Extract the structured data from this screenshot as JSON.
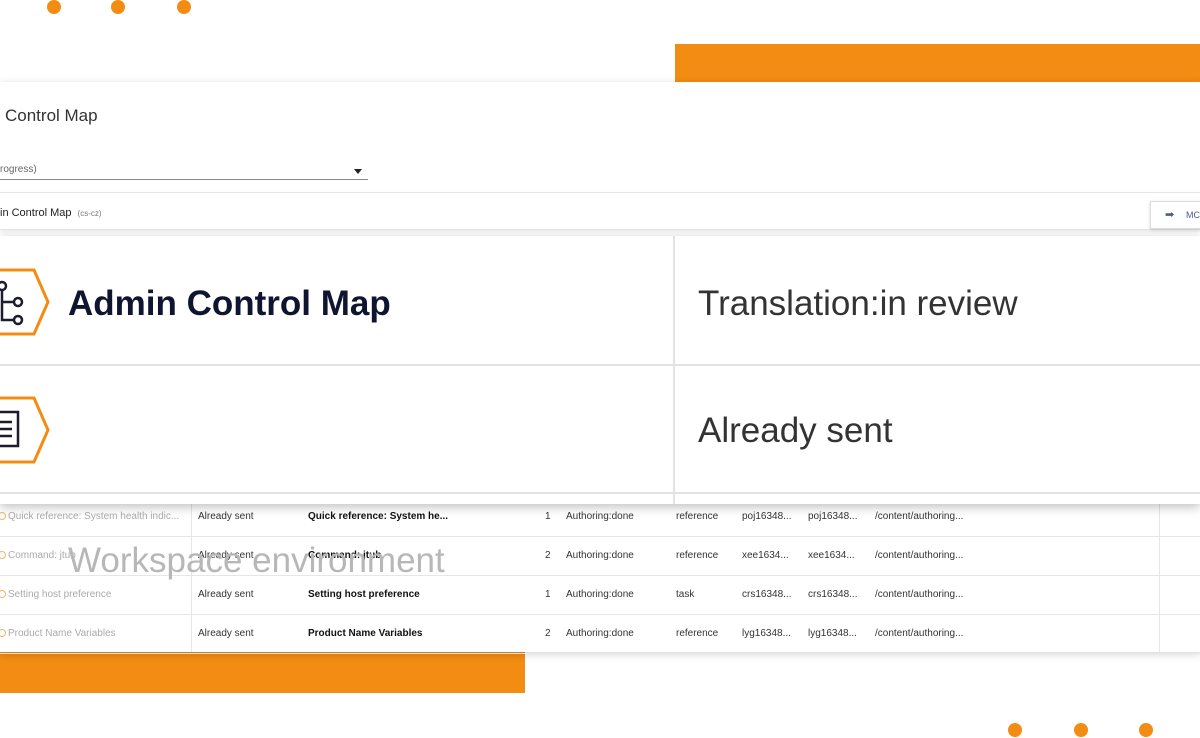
{
  "window": {
    "title": "Control Map",
    "select_value": "rogress)"
  },
  "map_header": {
    "title": "in Control Map",
    "locale": "(cs-cz)",
    "move_button_label": "MC"
  },
  "zoom_panel": {
    "map_title": "Admin Control Map",
    "workspace_label": "Workspace environment",
    "translation_status": "Translation:in review",
    "sent_status": "Already sent"
  },
  "rows": [
    {
      "title": "Quick reference: System health indic...",
      "status": "Already sent",
      "name": "Quick reference: System he...",
      "version": "1",
      "authoring": "Authoring:done",
      "type": "reference",
      "id1": "poj16348...",
      "id2": "poj16348...",
      "path": "/content/authoring..."
    },
    {
      "title": "Command: jtub",
      "status": "Already sent",
      "name": "Command: jtub",
      "version": "2",
      "authoring": "Authoring:done",
      "type": "reference",
      "id1": "xee1634...",
      "id2": "xee1634...",
      "path": "/content/authoring..."
    },
    {
      "title": "Setting host preference",
      "status": "Already sent",
      "name": "Setting host preference",
      "version": "1",
      "authoring": "Authoring:done",
      "type": "task",
      "id1": "crs16348...",
      "id2": "crs16348...",
      "path": "/content/authoring..."
    },
    {
      "title": "Product Name Variables",
      "status": "Already sent",
      "name": "Product Name Variables",
      "version": "2",
      "authoring": "Authoring:done",
      "type": "reference",
      "id1": "lyg16348...",
      "id2": "lyg16348...",
      "path": "/content/authoring..."
    }
  ],
  "colors": {
    "accent": "#f28c12",
    "title_dark": "#0f1430",
    "muted": "#b7b7b7"
  }
}
